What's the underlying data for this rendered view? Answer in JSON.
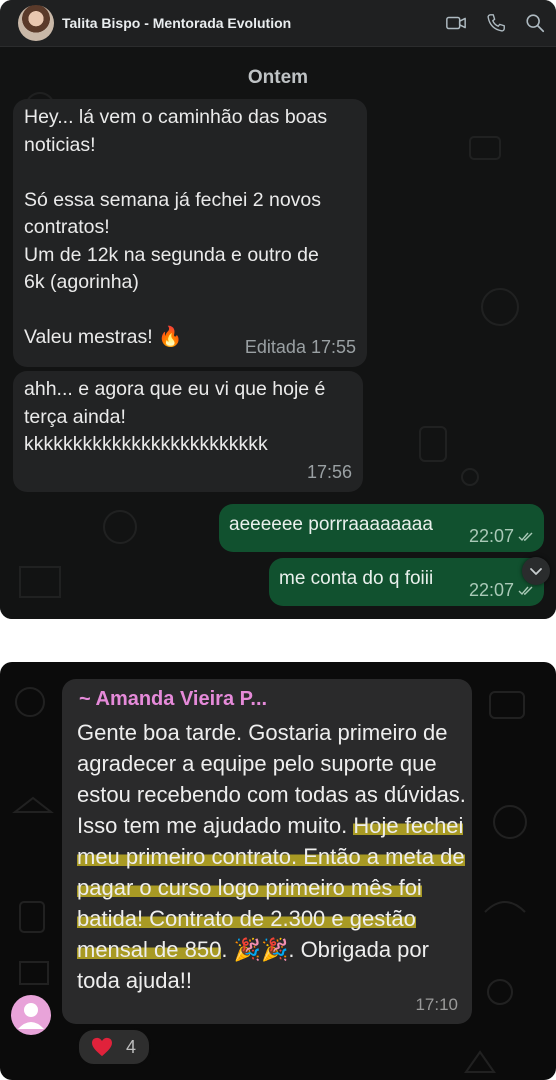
{
  "chat1": {
    "contact_name": "Talita Bispo - Mentorada Evolution",
    "day_separator": "Ontem",
    "messages": [
      {
        "direction": "in",
        "text": "Hey... lá vem o caminhão das boas\nnoticias!\n\nSó essa semana já fechei 2 novos\ncontratos!\nUm de 12k na segunda e outro de\n6k (agorinha)\n\nValeu mestras! 🔥",
        "meta": "Editada 17:55"
      },
      {
        "direction": "in",
        "text": "ahh... e agora que eu vi que hoje é\nterça ainda!\nkkkkkkkkkkkkkkkkkkkkkkkkk",
        "meta": "17:56"
      },
      {
        "direction": "out",
        "text": "aeeeeee porrraaaaaaaa",
        "meta": "22:07"
      },
      {
        "direction": "out",
        "text": "me conta do q foiii",
        "meta": "22:07"
      }
    ]
  },
  "chat2": {
    "sender": "~ Amanda Vieira P...",
    "text_plain_1": "Gente boa tarde. Gostaria primeiro de agradecer a equipe pelo suporte que estou recebendo com todas as dúvidas. Isso tem me ajudado muito. ",
    "text_highlight": "Hoje fechei meu primeiro contrato. Então a meta de pagar o curso logo primeiro mês foi batida! Contrato de 2.300 e gestão mensal de 850",
    "text_plain_2": ". 🎉🎉. Obrigada por toda ajuda!!",
    "time": "17:10",
    "reaction_emoji": "❤️",
    "reaction_count": "4"
  },
  "colors": {
    "outgoing_bubble": "#11512f",
    "incoming_bubble": "#222324",
    "sender_name": "#e58ad9",
    "highlight": "#c4b222"
  }
}
